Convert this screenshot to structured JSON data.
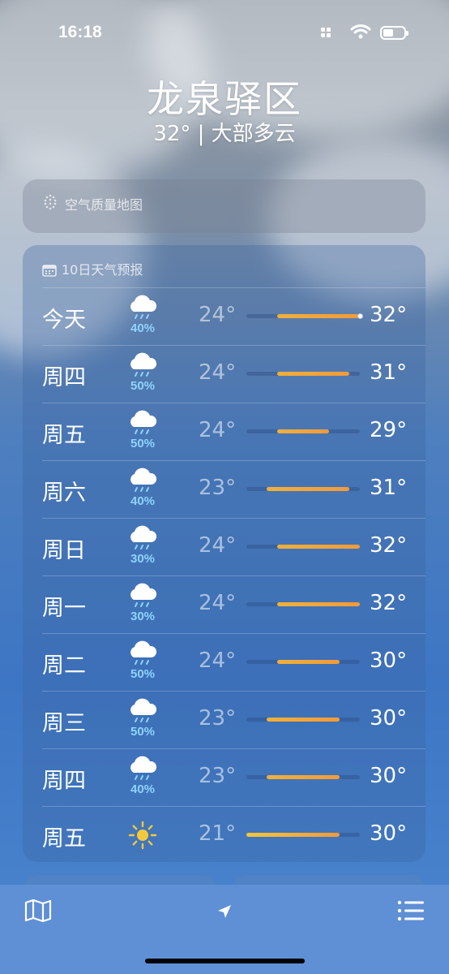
{
  "status_bar": {
    "time": "16:18"
  },
  "location": {
    "city": "龙泉驿区",
    "current": "32° | 大部多云"
  },
  "air_quality": {
    "label": "空气质量地图"
  },
  "forecast": {
    "header": "10日天气预报",
    "range_low": 21,
    "range_high": 32,
    "days": [
      {
        "day": "今天",
        "icon": "rain-cloud-icon",
        "precip": "40%",
        "low": "24°",
        "high": "32°",
        "lo_val": 24,
        "hi_val": 32,
        "current_marker": 32
      },
      {
        "day": "周四",
        "icon": "rain-cloud-icon",
        "precip": "50%",
        "low": "24°",
        "high": "31°",
        "lo_val": 24,
        "hi_val": 31
      },
      {
        "day": "周五",
        "icon": "rain-cloud-icon",
        "precip": "50%",
        "low": "24°",
        "high": "29°",
        "lo_val": 24,
        "hi_val": 29
      },
      {
        "day": "周六",
        "icon": "rain-cloud-icon",
        "precip": "40%",
        "low": "23°",
        "high": "31°",
        "lo_val": 23,
        "hi_val": 31
      },
      {
        "day": "周日",
        "icon": "rain-cloud-icon",
        "precip": "30%",
        "low": "24°",
        "high": "32°",
        "lo_val": 24,
        "hi_val": 32
      },
      {
        "day": "周一",
        "icon": "rain-cloud-icon",
        "precip": "30%",
        "low": "24°",
        "high": "32°",
        "lo_val": 24,
        "hi_val": 32
      },
      {
        "day": "周二",
        "icon": "rain-cloud-icon",
        "precip": "50%",
        "low": "24°",
        "high": "30°",
        "lo_val": 24,
        "hi_val": 30
      },
      {
        "day": "周三",
        "icon": "rain-cloud-icon",
        "precip": "50%",
        "low": "23°",
        "high": "30°",
        "lo_val": 23,
        "hi_val": 30
      },
      {
        "day": "周四",
        "icon": "rain-cloud-icon",
        "precip": "40%",
        "low": "23°",
        "high": "30°",
        "lo_val": 23,
        "hi_val": 30
      },
      {
        "day": "周五",
        "icon": "sun-icon",
        "precip": "",
        "low": "21°",
        "high": "30°",
        "lo_val": 21,
        "hi_val": 30
      }
    ]
  },
  "colors": {
    "bar_warm": "#f29a3a",
    "bar_yellow": "#f3c53e",
    "precip_blue": "#8fd3ff"
  },
  "toolbar": {
    "map_icon": "map-icon",
    "location_icon": "location-arrow-icon",
    "list_icon": "list-icon"
  }
}
